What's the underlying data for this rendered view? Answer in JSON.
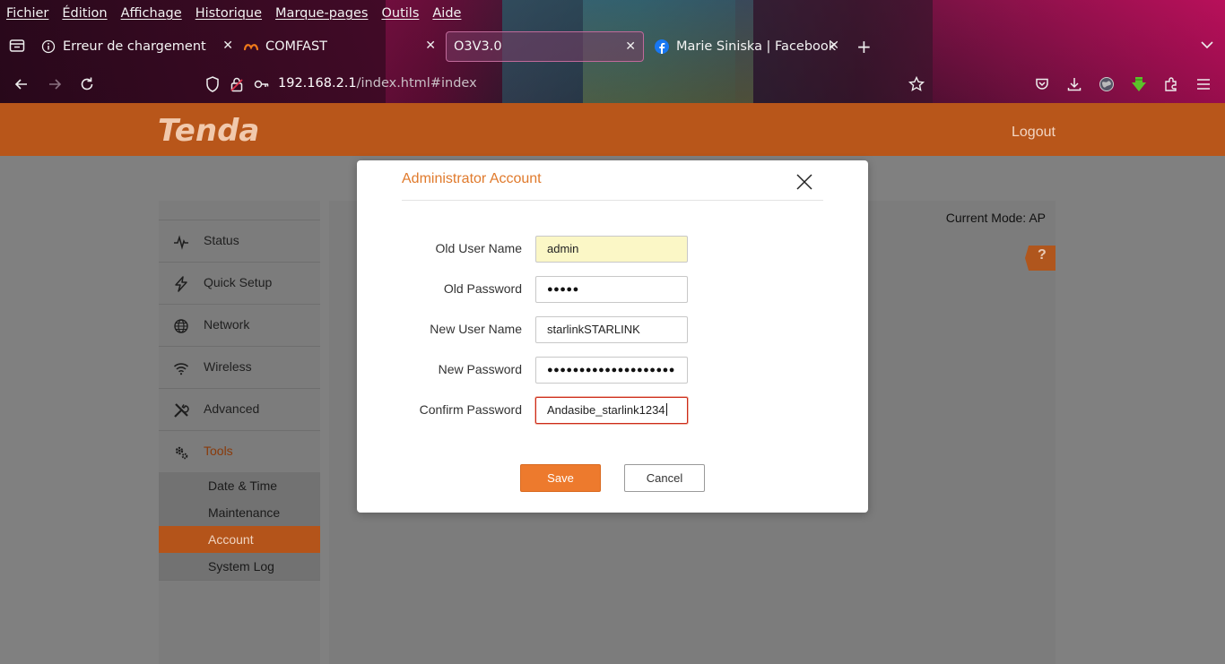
{
  "browser": {
    "menu": [
      "Fichier",
      "Édition",
      "Affichage",
      "Historique",
      "Marque-pages",
      "Outils",
      "Aide"
    ],
    "tabs": [
      {
        "title": "Erreur de chargement de",
        "icon": "info-icon",
        "active": false
      },
      {
        "title": "COMFAST",
        "icon": "comfast-logo-icon",
        "active": false
      },
      {
        "title": "O3V3.0",
        "icon": "",
        "active": true
      },
      {
        "title": "Marie Siniska | Facebook",
        "icon": "facebook-icon",
        "active": false
      }
    ],
    "url_host": "192.168.2.1",
    "url_path": "/index.html#index"
  },
  "router": {
    "brand": "Tenda",
    "logout": "Logout",
    "current_mode": "Current Mode: AP",
    "help": "?",
    "nav": [
      {
        "label": "Status",
        "icon": "pulse-icon"
      },
      {
        "label": "Quick Setup",
        "icon": "bolt-icon"
      },
      {
        "label": "Network",
        "icon": "globe-icon"
      },
      {
        "label": "Wireless",
        "icon": "wifi-icon"
      },
      {
        "label": "Advanced",
        "icon": "tools-icon"
      },
      {
        "label": "Tools",
        "icon": "gears-icon",
        "active": true
      }
    ],
    "tools_submenu": [
      {
        "label": "Date & Time"
      },
      {
        "label": "Maintenance"
      },
      {
        "label": "Account",
        "active": true
      },
      {
        "label": "System Log"
      }
    ],
    "accent_color": "#e07a2c"
  },
  "dialog": {
    "title": "Administrator Account",
    "fields": {
      "old_user": {
        "label": "Old User Name",
        "value": "admin"
      },
      "old_password": {
        "label": "Old Password",
        "value": "●●●●●"
      },
      "new_user": {
        "label": "New User Name",
        "value": "starlinkSTARLINK"
      },
      "new_password": {
        "label": "New Password",
        "value": "●●●●●●●●●●●●●●●●●●●●"
      },
      "confirm_password": {
        "label": "Confirm Password",
        "value": "Andasibe_starlink1234"
      }
    },
    "save": "Save",
    "cancel": "Cancel"
  }
}
